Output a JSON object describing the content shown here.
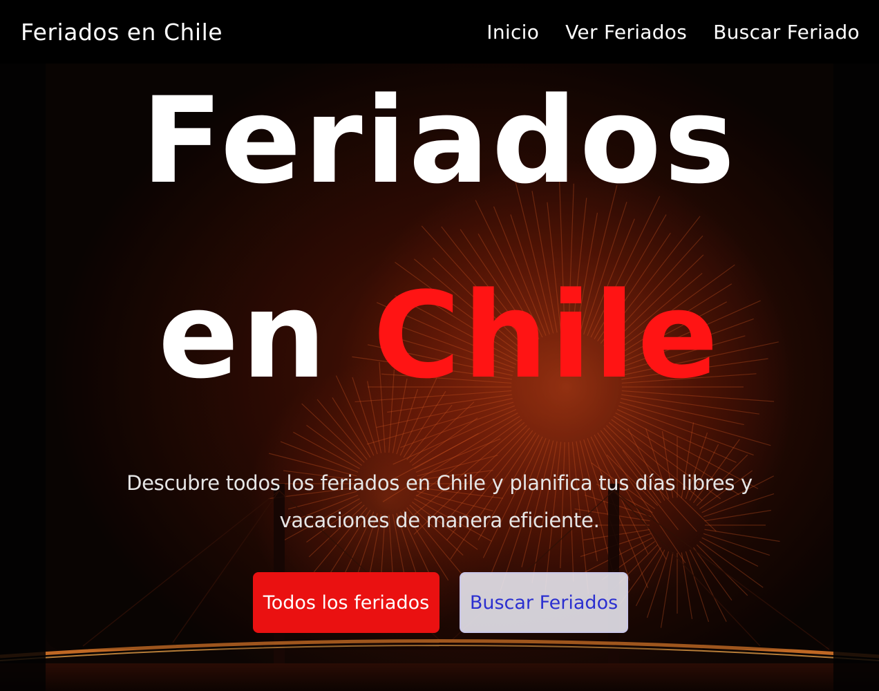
{
  "navbar": {
    "brand": "Feriados en Chile",
    "links": [
      "Inicio",
      "Ver Feriados",
      "Buscar Feriado"
    ]
  },
  "hero": {
    "title_line1": "Feriados",
    "title_line2_white": "en",
    "title_line2_accent": "Chile",
    "description": "Descubre todos los feriados en Chile y planifica tus días libres y vacaciones de manera eficiente.",
    "primary_button": "Todos los feriados",
    "secondary_button": "Buscar Feriados"
  },
  "colors": {
    "accent": "#ff1414",
    "primary_button": "#ea1111",
    "secondary_button_text": "#2b2fd0",
    "navbar": "#000000"
  },
  "icons": [
    "fireworks-background-image"
  ]
}
